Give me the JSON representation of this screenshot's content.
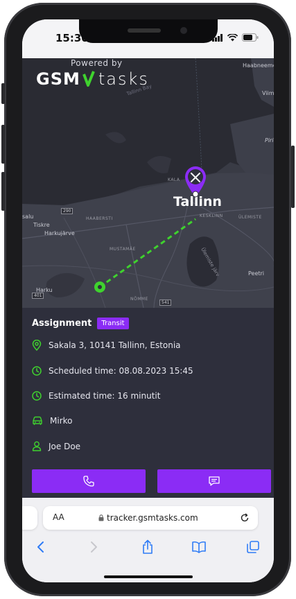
{
  "status": {
    "time": "15:30"
  },
  "map": {
    "powered_by": "Powered by",
    "logo_gsm": "GSM",
    "logo_tasks": "tasks",
    "city": "Tallinn",
    "labels": {
      "haabneeme": "Haabneeme",
      "viimsi": "Viim",
      "pirita": "Piri",
      "saku": "salu",
      "tiskre": "Tiskre",
      "harkujarve": "Harkujärve",
      "harku": "Harku",
      "peetri": "Peetri",
      "ulemiste_jarv": "Ülemiste järv",
      "tallinn_bay": "Tallinn Bay"
    },
    "road_labels": {
      "haabersti": "HAABERSTI",
      "mustamae": "MUSTAMÄE",
      "kesklinn": "KESKLINN",
      "ulemiste": "ÜLEMISTE",
      "nomme": "NÕMME",
      "kalamaja": "KALA"
    },
    "road_badges": [
      "290",
      "401",
      "541"
    ]
  },
  "assignment": {
    "title": "Assignment",
    "badge": "Transit",
    "address": "Sakala 3, 10141 Tallinn, Estonia",
    "scheduled": "Scheduled time: 08.08.2023 15:45",
    "estimated": "Estimated time: 16 minutit",
    "vehicle": "Mirko",
    "contact": "Joe Doe"
  },
  "browser": {
    "aa": "AA",
    "url": "tracker.gsmtasks.com"
  },
  "colors": {
    "accent": "#8b2cf5",
    "route": "#3fd22e",
    "sheet_bg": "#2e2f3c",
    "map_bg": "#393b45",
    "icon_green": "#3fd22e"
  }
}
